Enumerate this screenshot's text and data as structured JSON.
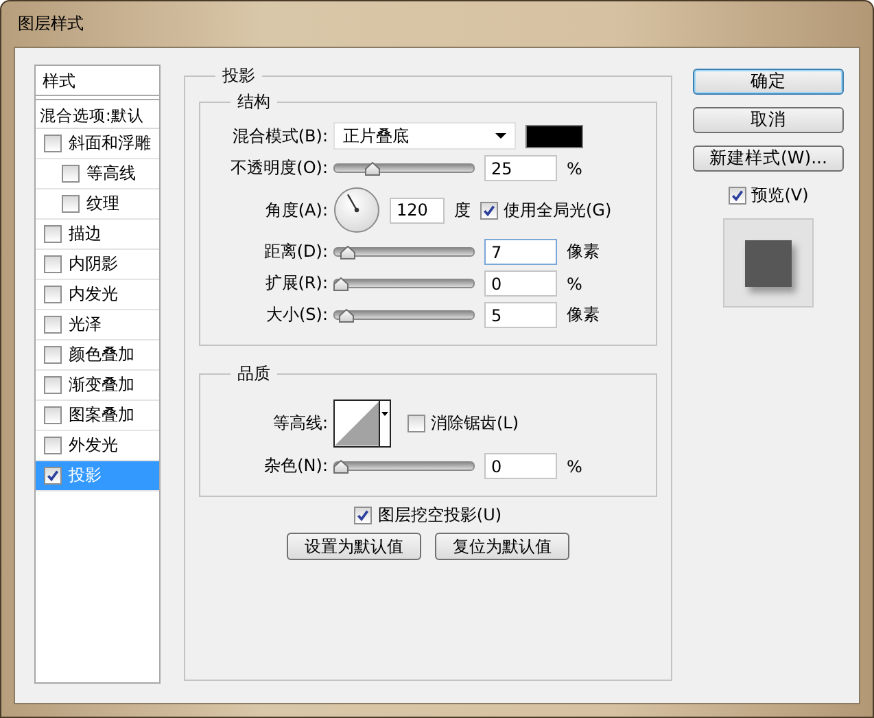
{
  "window": {
    "title": "图层样式"
  },
  "sidebar": {
    "header": "样式",
    "blend_options": "混合选项:默认",
    "items": [
      {
        "label": "斜面和浮雕",
        "checked": false,
        "selected": false,
        "children": [
          {
            "label": "等高线",
            "checked": false,
            "selected": false
          },
          {
            "label": "纹理",
            "checked": false,
            "selected": false
          }
        ]
      },
      {
        "label": "描边",
        "checked": false,
        "selected": false
      },
      {
        "label": "内阴影",
        "checked": false,
        "selected": false
      },
      {
        "label": "内发光",
        "checked": false,
        "selected": false
      },
      {
        "label": "光泽",
        "checked": false,
        "selected": false
      },
      {
        "label": "颜色叠加",
        "checked": false,
        "selected": false
      },
      {
        "label": "渐变叠加",
        "checked": false,
        "selected": false
      },
      {
        "label": "图案叠加",
        "checked": false,
        "selected": false
      },
      {
        "label": "外发光",
        "checked": false,
        "selected": false
      },
      {
        "label": "投影",
        "checked": true,
        "selected": true
      }
    ]
  },
  "panel": {
    "title": "投影",
    "structure": {
      "title": "结构",
      "blend_mode": {
        "label": "混合模式(B):",
        "value": "正片叠底",
        "color": "#000000"
      },
      "opacity": {
        "label": "不透明度(O):",
        "level": 0.25,
        "value": "25",
        "unit": "%",
        "focused": false
      },
      "angle": {
        "label": "角度(A):",
        "value": "120",
        "unit": "度"
      },
      "global_light": {
        "label": "使用全局光(G)",
        "checked": true
      },
      "distance": {
        "label": "距离(D):",
        "level": 0.05,
        "value": "7",
        "unit": "像素",
        "focused": true
      },
      "spread": {
        "label": "扩展(R):",
        "level": 0,
        "value": "0",
        "unit": "%",
        "focused": false
      },
      "size": {
        "label": "大小(S):",
        "level": 0.04,
        "value": "5",
        "unit": "像素",
        "focused": false
      }
    },
    "quality": {
      "title": "品质",
      "contour": {
        "label": "等高线:"
      },
      "anti_alias": {
        "label": "消除锯齿(L)",
        "checked": false
      },
      "noise": {
        "label": "杂色(N):",
        "level": 0,
        "value": "0",
        "unit": "%",
        "focused": false
      }
    },
    "knockout": {
      "label": "图层挖空投影(U)",
      "checked": true
    },
    "buttons": [
      "设置为默认值",
      "复位为默认值"
    ]
  },
  "actions": {
    "buttons": [
      {
        "label": "确定",
        "focused": true
      },
      {
        "label": "取消",
        "focused": false
      },
      {
        "label": "新建样式(W)...",
        "focused": false
      }
    ],
    "preview": {
      "label": "预览(V)",
      "checked": true
    }
  }
}
